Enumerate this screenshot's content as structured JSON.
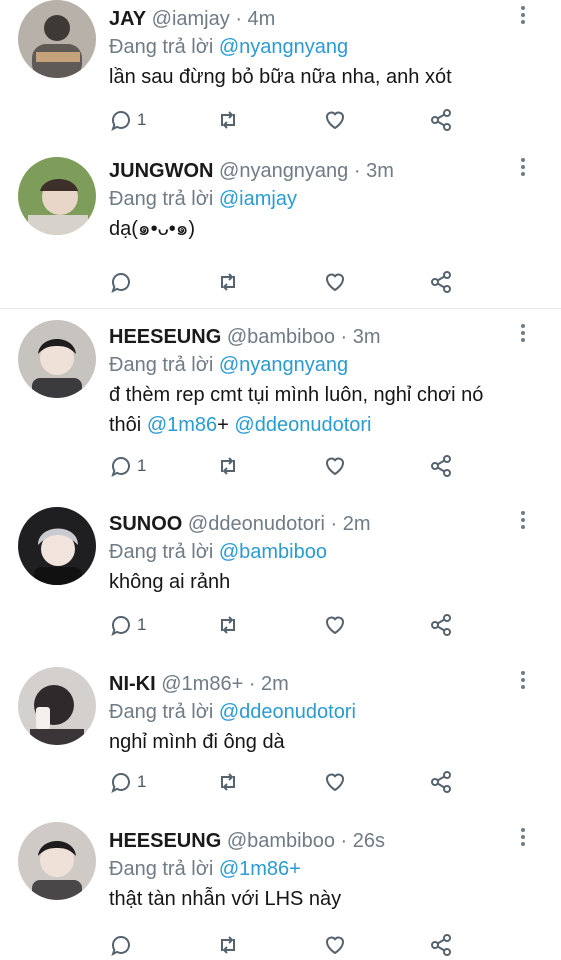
{
  "reply_prefix": "Đang trả lời",
  "tweets": [
    {
      "name": "JAY",
      "handle": "@iamjay",
      "time": "· 4m",
      "replying_to": "@nyangnyang",
      "text": "lần sau đừng bỏ bữa nữa nha, anh xót",
      "reply_count": "1",
      "avatar_color": "#5f5a55"
    },
    {
      "name": "JUNGWON",
      "handle": "@nyangnyang",
      "time": "· 3m",
      "replying_to": "@iamjay",
      "text": "dạ(๑•ᴗ•๑)",
      "reply_count": "",
      "avatar_color": "#5d7a45"
    },
    {
      "name": "HEESEUNG",
      "handle": "@bambiboo",
      "time": "· 3m",
      "replying_to": "@nyangnyang",
      "text_line1": "đ thèm rep cmt tụi mình luôn, nghỉ chơi nó",
      "text_line2_prefix": "thôi ",
      "text_mention1": "@1m86",
      "text_plus": "+ ",
      "text_mention2": "@ddeonudotori",
      "reply_count": "1",
      "avatar_color": "#3b3a3c"
    },
    {
      "name": "SUNOO",
      "handle": "@ddeonudotori",
      "time": "· 2m",
      "replying_to": "@bambiboo",
      "text": "không ai rảnh",
      "reply_count": "1",
      "avatar_color": "#8c8c8e"
    },
    {
      "name": "NI-KI",
      "handle": "@1m86+",
      "time": "· 2m",
      "replying_to": "@ddeonudotori",
      "text": "nghỉ mình đi ông dà",
      "reply_count": "1",
      "avatar_color": "#2e2a2b"
    },
    {
      "name": "HEESEUNG",
      "handle": "@bambiboo",
      "time": "· 26s",
      "replying_to": "@1m86+",
      "text": "thật tàn nhẫn với LHS này",
      "reply_count": "",
      "avatar_color": "#4a4748"
    }
  ],
  "colors": {
    "mention": "#2a9bd3",
    "meta": "#6f7b85",
    "icon": "#56636d"
  },
  "icons": [
    "reply-icon",
    "retweet-icon",
    "like-icon",
    "share-icon",
    "more-icon"
  ]
}
